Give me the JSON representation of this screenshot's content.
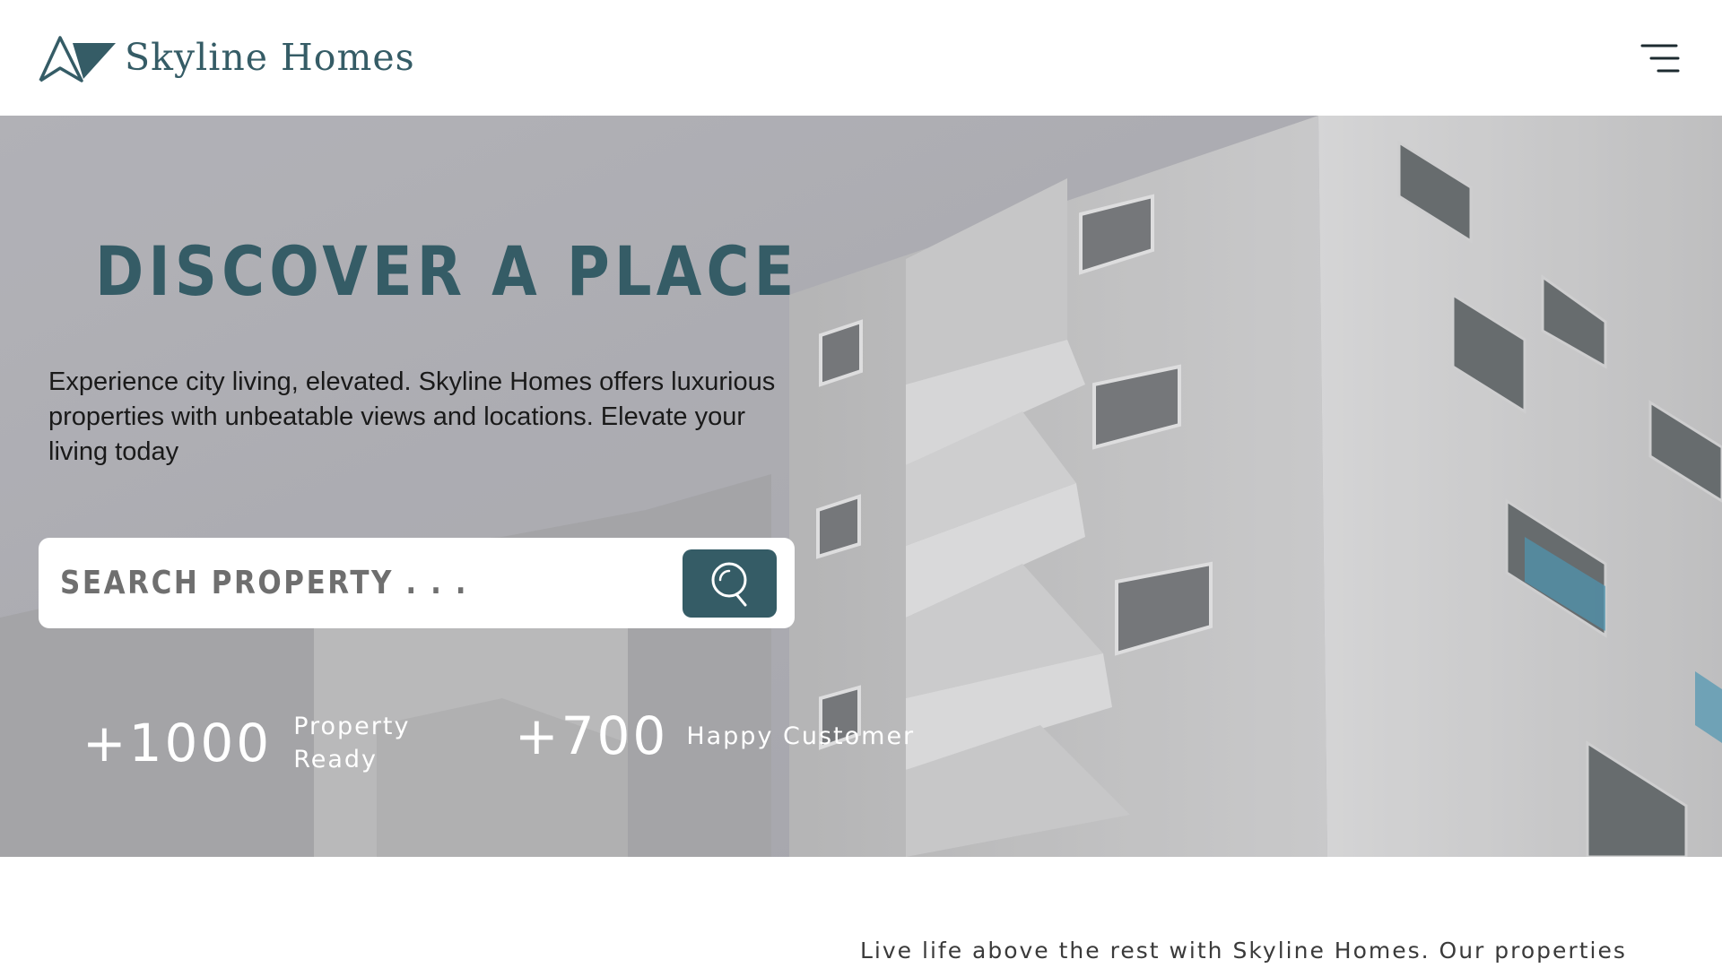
{
  "header": {
    "brand_name": "Skyline Homes",
    "logo_icon": "mountain-peaks-logo",
    "menu_icon": "hamburger-menu-icon"
  },
  "hero": {
    "title": "DISCOVER A PLACE",
    "description": "Experience city living, elevated. Skyline Homes offers luxurious properties with unbeatable views and locations. Elevate your living today",
    "background": "white apartment building with balconies",
    "search": {
      "placeholder": "SEARCH PROPERTY . . .",
      "value": "",
      "button_icon": "search-icon"
    },
    "stats": [
      {
        "value": "+1000",
        "label": "Property Ready"
      },
      {
        "value": "+700",
        "label": "Happy Customer"
      }
    ]
  },
  "intro": {
    "text": "Live life above the rest with Skyline Homes. Our properties"
  },
  "colors": {
    "brand": "#355c66",
    "hero_overlay": "#b5b5b9",
    "white": "#ffffff"
  }
}
